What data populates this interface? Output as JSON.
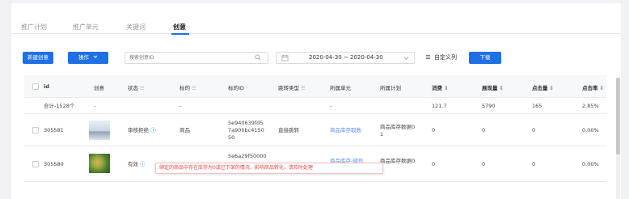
{
  "tabs": [
    {
      "label": "推广计划"
    },
    {
      "label": "推广单元"
    },
    {
      "label": "关键词"
    },
    {
      "label": "创意"
    }
  ],
  "toolbar": {
    "new_label": "新建创意",
    "action_label": "操作",
    "search_placeholder": "搜索创意ID",
    "date_range": "2020-04-30 ~ 2020-04-30",
    "custom_columns_label": "自定义列",
    "download_label": "下载"
  },
  "table": {
    "columns": [
      "id",
      "创意",
      "状态",
      "标的",
      "标的ID",
      "跳转类型",
      "所属单元",
      "所属计划",
      "消费",
      "展现量",
      "点击量",
      "点击率"
    ],
    "summary": {
      "id": "合计-1528个",
      "creative": "-",
      "target": "-",
      "unit": "-",
      "spend": "121.7",
      "impressions": "5790",
      "clicks": "165",
      "ctr": "2.85%"
    },
    "rows": [
      {
        "id": "305581",
        "status": "审核拒绝",
        "target": "商品",
        "target_id_l1": "5e940639fd5",
        "target_id_l2": "7a900bc4150",
        "target_id_l3": "50",
        "jump_type": "直接跳转",
        "unit": "商品库存取数",
        "plan_l1": "商品库存数据0",
        "plan_l2": "1",
        "spend": "0",
        "impressions": "0",
        "clicks": "0",
        "ctr": "0.00%"
      },
      {
        "id": "305580",
        "status": "有效",
        "target_id_l1": "5e6a29f50000",
        "target_id_l3": "3",
        "unit": "商品库存-微信",
        "plan_l1": "商品库存数据0",
        "plan_l2": "1",
        "spend": "0",
        "impressions": "0",
        "clicks": "0",
        "ctr": "0.00%"
      }
    ]
  },
  "tooltip": {
    "text": "绑定的商品中存在库存为0或已下架的情况，影响商品转化，请及时处理"
  },
  "colors": {
    "primary": "#1f6fe5",
    "link": "#5a8fe8",
    "error": "#e24646"
  }
}
